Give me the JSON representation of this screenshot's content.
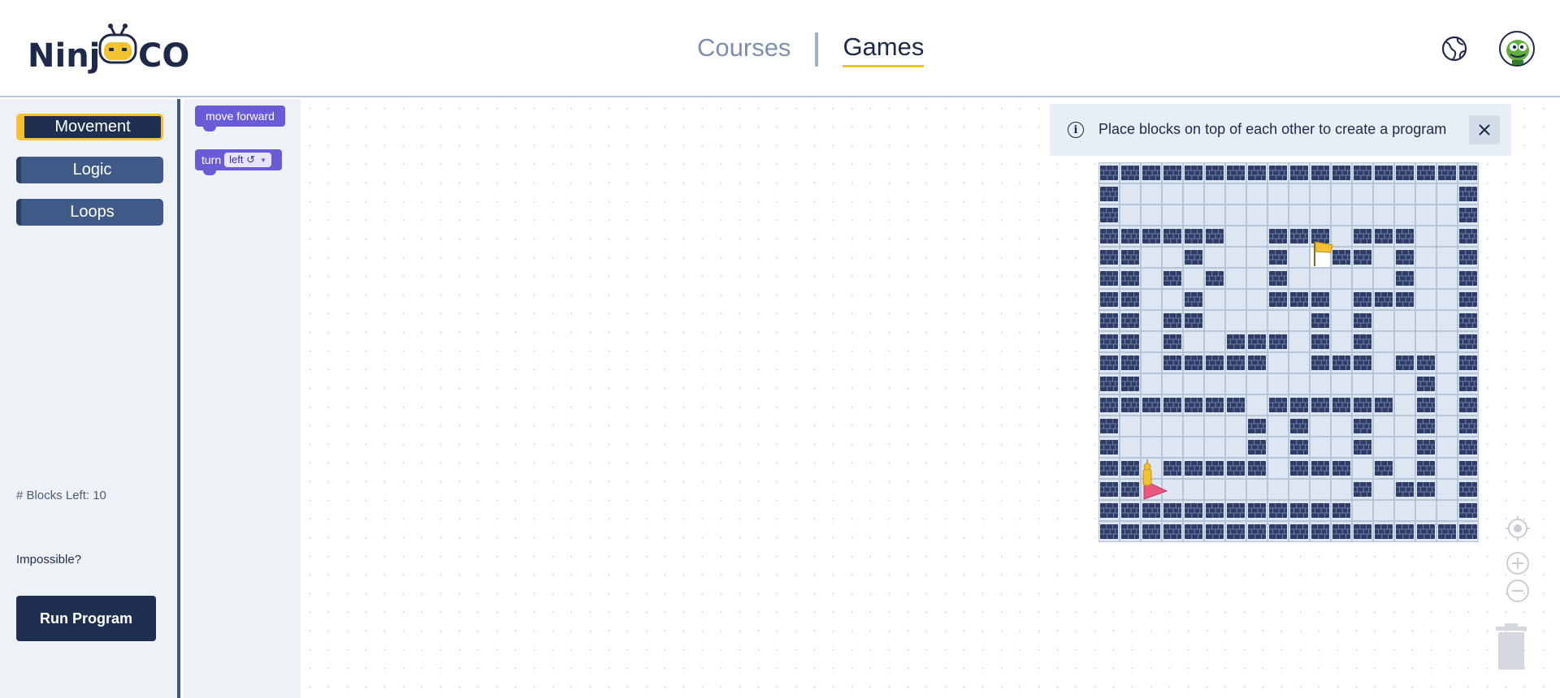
{
  "header": {
    "logo_left": "Ninj",
    "logo_right": "CO",
    "nav": [
      {
        "label": "Courses",
        "active": false
      },
      {
        "label": "Games",
        "active": true
      }
    ],
    "globe_icon": "globe-icon",
    "avatar_icon": "dino-avatar-icon"
  },
  "sidebar": {
    "categories": [
      {
        "label": "Movement",
        "active": true
      },
      {
        "label": "Logic",
        "active": false
      },
      {
        "label": "Loops",
        "active": false
      }
    ],
    "blocks_left": "# Blocks Left: 10",
    "impossible": "Impossible?",
    "run_button": "Run Program"
  },
  "flyout": {
    "blocks": [
      {
        "label": "move forward"
      },
      {
        "label": "turn",
        "dropdown": "left ↺"
      }
    ]
  },
  "workspace": {
    "info": {
      "text": "Place blocks on top of each other to create a program",
      "icon": "info-icon",
      "close_icon": "close-icon"
    },
    "maze": {
      "rows": 18,
      "cols": 18,
      "wall_color": "#2f3d66",
      "floor_color": "#dde6f1",
      "grid": [
        "##################",
        "#................#",
        "#................#",
        "######..###.###..#",
        "##..#...#G###.#..#",
        "##.#.#..#.....#..#",
        "##..#...###.###..#",
        "##.##.....#.#....#",
        "##.#..###.#.#....#",
        "##.#####..###.##.#",
        "##.............#.#",
        "#######.######.#.#",
        "#......#.#..#..#.#",
        "#......#.#..#..#.#",
        "##.#####.###.#.#.#",
        "##..........#.##.#",
        "############.....#",
        "##################"
      ],
      "player": {
        "row": 15,
        "col": 2,
        "facing": "east"
      },
      "goal": {
        "row": 4,
        "col": 10
      }
    },
    "controls": [
      "recenter-icon",
      "zoom-in-icon",
      "zoom-out-icon",
      "trash-icon"
    ]
  }
}
